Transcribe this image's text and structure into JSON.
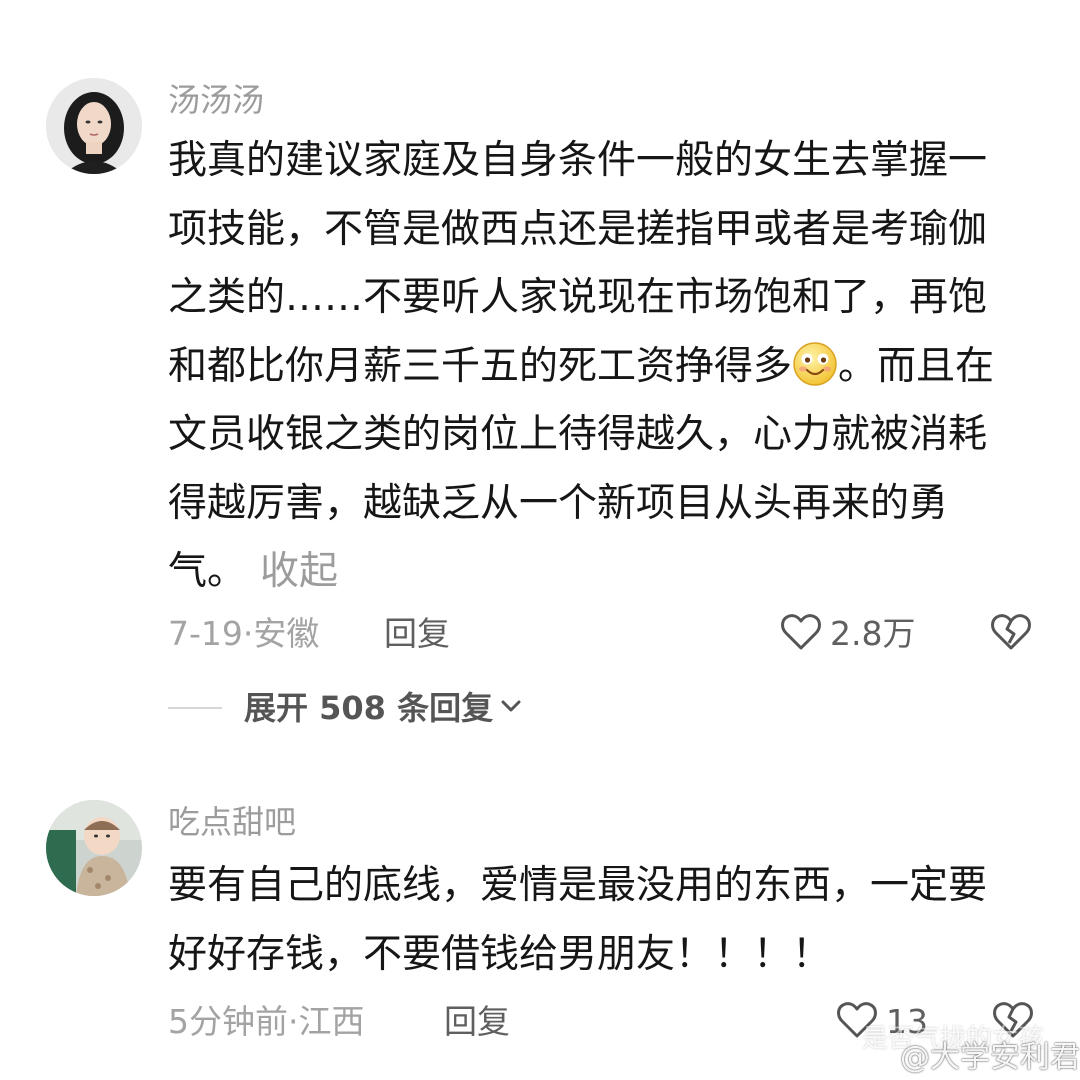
{
  "top_fragment": "",
  "comments": [
    {
      "username": "汤汤汤",
      "body": {
        "part1": "我真的建议家庭及自身条件一般的女生去掌握一项技能，不管是做西点还是搓指甲或者是考瑜伽之类的……不要听人家说现在市场饱和了，再饱和都比你月薪三千五的死工资挣得多",
        "emoji": "smiling-face-emoji",
        "part2": "。而且在文员收银之类的岗位上待得越久，心力就被消耗得越厉害，越缺乏从一个新项目从头再来的勇气。"
      },
      "collapse_label": "收起",
      "date": "7-19",
      "location": "安徽",
      "meta_sep": "·",
      "reply_label": "回复",
      "like_count": "2.8万",
      "expand_replies_label": "展开 508 条回复"
    },
    {
      "username": "吃点甜吧",
      "body": {
        "part1": "要有自己的底线，爱情是最没用的东西，一定要好好存钱，不要借钱给男朋友！！！！"
      },
      "date": "5分钟前",
      "location": "江西",
      "meta_sep": "·",
      "reply_label": "回复",
      "like_count": "13"
    }
  ],
  "watermark": {
    "line1": "@大学安利君",
    "line2": "是否气拢的女孩"
  },
  "icons": {
    "like": "heart-outline-icon",
    "dislike": "broken-heart-icon",
    "expand": "chevron-down-icon"
  },
  "colors": {
    "text_primary": "#161616",
    "text_secondary": "#9c9c9c",
    "action_text": "#5f5f5f",
    "background": "#ffffff"
  }
}
